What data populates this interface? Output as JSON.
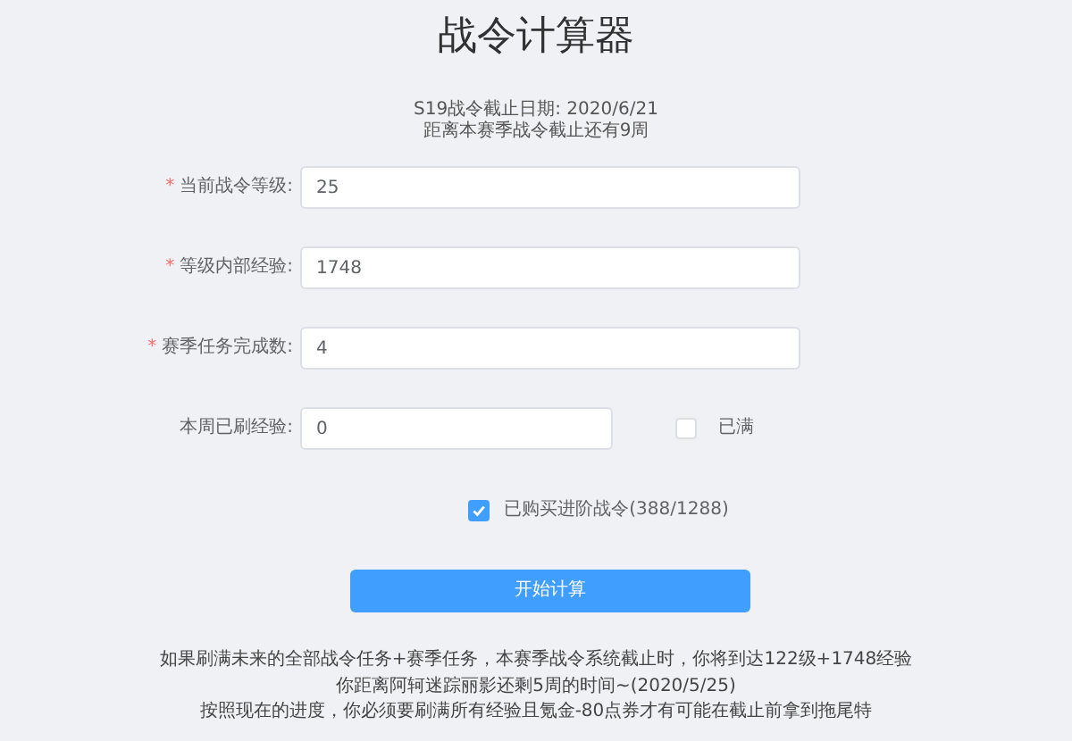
{
  "title": "战令计算器",
  "info": [
    "S19战令截止日期: 2020/6/21",
    "距离本赛季战令截止还有9周"
  ],
  "fields": [
    {
      "marker": "*",
      "label": "当前战令等级:",
      "value": "25"
    },
    {
      "marker": "*",
      "label": "等级内部经验:",
      "value": "1748"
    },
    {
      "marker": "*",
      "label": "赛季任务完成数:",
      "value": "4"
    },
    {
      "label": "本周已刷经验:",
      "value": "0",
      "checkbox": {
        "label": "已满",
        "checked": false
      }
    }
  ],
  "purchase": {
    "label": "已购买进阶战令(388/1288)",
    "checked": true
  },
  "button": "开始计算",
  "results": [
    "如果刷满未来的全部战令任务+赛季任务，本赛季战令系统截止时，你将到达122级+1748经验",
    "你距离阿轲迷踪丽影还剩5周的时间~(2020/5/25)",
    "按照现在的进度，你必须要刷满所有经验且氪金-80点券才有可能在截止前拿到拖尾特"
  ]
}
